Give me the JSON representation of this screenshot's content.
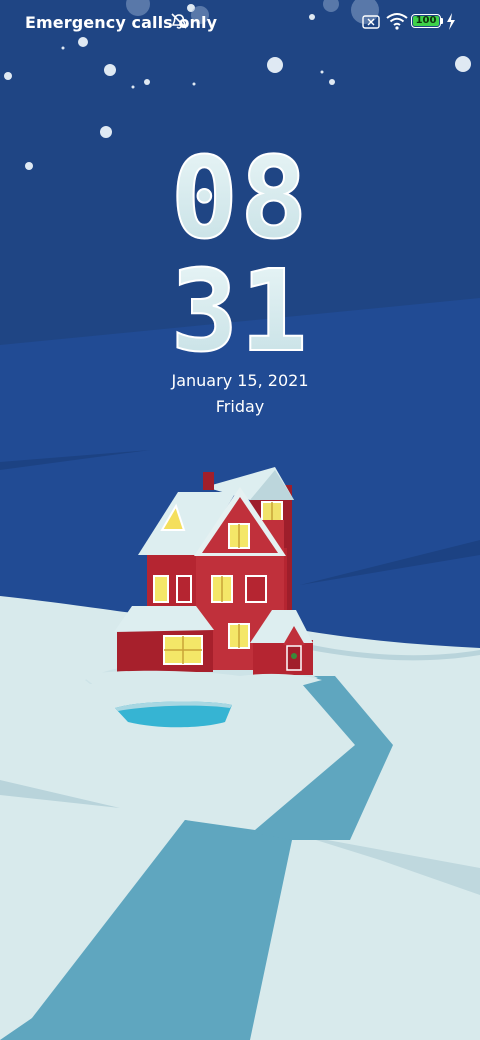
{
  "status_bar": {
    "carrier_text": "Emergency calls only",
    "battery_level": "100",
    "icons": [
      "alarm-off-icon",
      "sim-card-icon",
      "wifi-icon",
      "battery-icon",
      "charging-icon"
    ]
  },
  "lock_screen": {
    "clock_hours": "08",
    "clock_minutes": "31",
    "date": "January 15, 2021",
    "weekday": "Friday"
  },
  "colors": {
    "sky": "#1f4a8f",
    "snow": "#d8eaec",
    "house": "#b52531",
    "river": "#5fa6bf",
    "battery_green": "#3fd14a"
  }
}
